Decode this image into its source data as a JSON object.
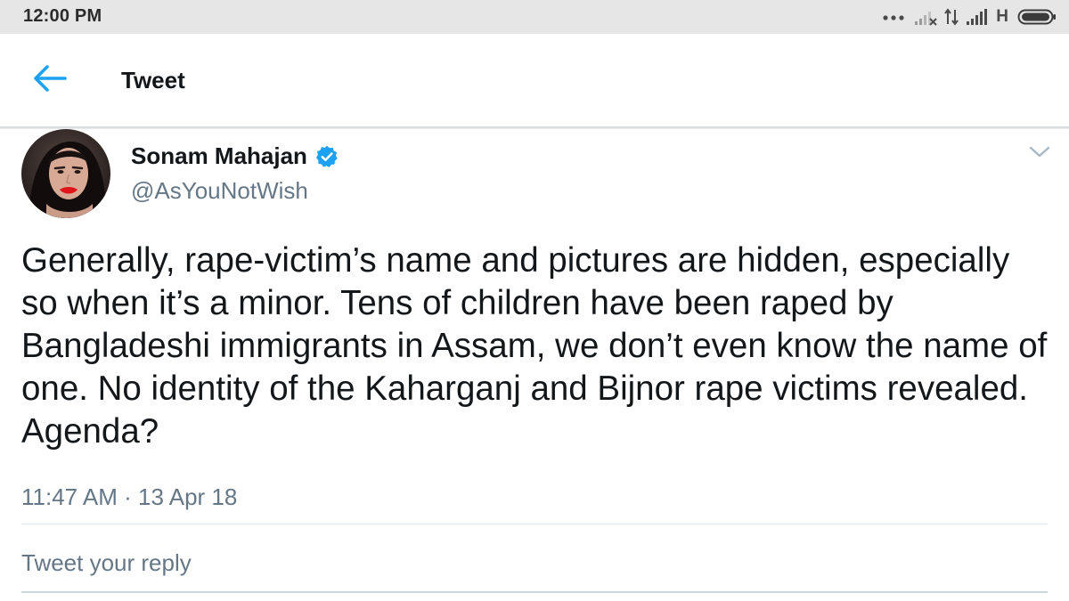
{
  "status_bar": {
    "time": "12:00 PM",
    "network_type": "H",
    "icons": [
      "more-dots-icon",
      "signal-sim1-icon",
      "data-transfer-icon",
      "signal-sim2-icon",
      "battery-icon"
    ]
  },
  "toolbar": {
    "back_icon": "arrow-left-icon",
    "title": "Tweet"
  },
  "tweet": {
    "author_name": "Sonam Mahajan",
    "verified": true,
    "handle": "@AsYouNotWish",
    "text": "Generally, rape-victim’s name and pictures are hidden, especially so when it’s a minor. Tens of children have been raped by Bangladeshi immigrants in Assam, we don’t even know the name of one. No identity of the Kaharganj and Bijnor rape victims revealed. Agenda?",
    "timestamp": "11:47 AM · 13 Apr 18",
    "menu_icon": "chevron-down-icon"
  },
  "reply": {
    "placeholder": "Tweet your reply",
    "value": ""
  },
  "colors": {
    "accent": "#1da1f2",
    "text_primary": "#14171a",
    "text_secondary": "#657786",
    "status_bar_bg": "#e6e6e6",
    "divider": "#e1e8ed"
  }
}
